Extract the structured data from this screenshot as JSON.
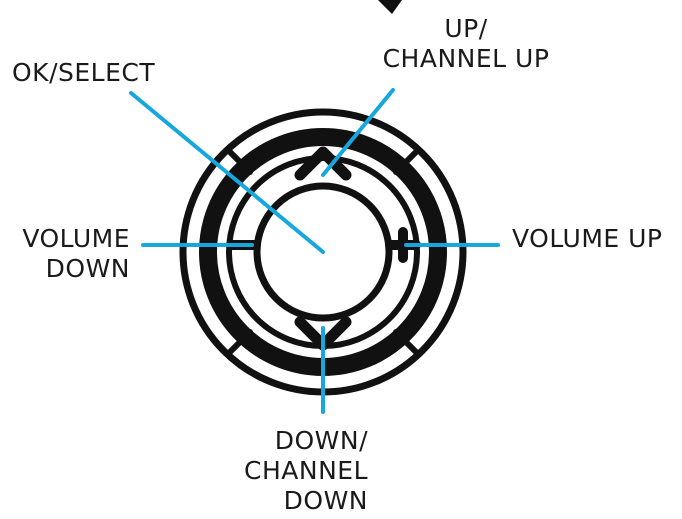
{
  "labels": {
    "up": [
      "UP/",
      "CHANNEL UP"
    ],
    "ok": "OK/SELECT",
    "volume_down": [
      "VOLUME",
      "DOWN"
    ],
    "volume_up": "VOLUME UP",
    "down": [
      "DOWN/",
      "CHANNEL",
      "DOWN"
    ]
  },
  "colors": {
    "outline": "#111111",
    "callout": "#16a7df",
    "background": "#ffffff"
  }
}
